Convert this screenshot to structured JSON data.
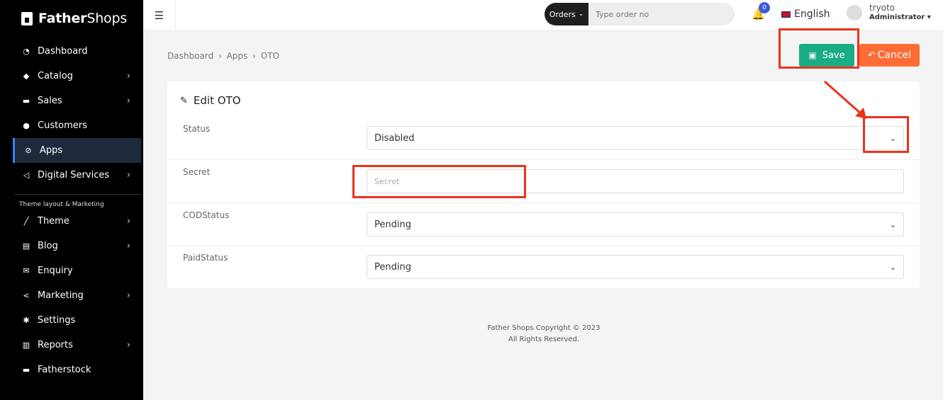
{
  "brand": {
    "name_bold": "Father",
    "name_regular": "Shops"
  },
  "sidebar": {
    "items": [
      {
        "label": "Dashboard",
        "icon": "dashboard-icon",
        "glyph": "◔",
        "has_submenu": false
      },
      {
        "label": "Catalog",
        "icon": "tag-icon",
        "glyph": "◆",
        "has_submenu": true
      },
      {
        "label": "Sales",
        "icon": "cart-icon",
        "glyph": "▬",
        "has_submenu": true
      },
      {
        "label": "Customers",
        "icon": "user-icon",
        "glyph": "●",
        "has_submenu": false
      },
      {
        "label": "Apps",
        "icon": "apps-icon",
        "glyph": "⊘",
        "has_submenu": false,
        "active": true
      },
      {
        "label": "Digital Services",
        "icon": "bullhorn-icon",
        "glyph": "◁",
        "has_submenu": true
      }
    ],
    "section_title": "Theme layout & Marketing",
    "items2": [
      {
        "label": "Theme",
        "icon": "brush-icon",
        "glyph": "╱",
        "has_submenu": true
      },
      {
        "label": "Blog",
        "icon": "newspaper-icon",
        "glyph": "▤",
        "has_submenu": true
      },
      {
        "label": "Enquiry",
        "icon": "envelope-icon",
        "glyph": "✉",
        "has_submenu": false
      },
      {
        "label": "Marketing",
        "icon": "share-icon",
        "glyph": "<",
        "has_submenu": true
      },
      {
        "label": "Settings",
        "icon": "gear-icon",
        "glyph": "✱",
        "has_submenu": false
      },
      {
        "label": "Reports",
        "icon": "chart-icon",
        "glyph": "▥",
        "has_submenu": true
      },
      {
        "label": "Fatherstock",
        "icon": "cart-icon",
        "glyph": "▬",
        "has_submenu": false
      }
    ],
    "chevron": "›"
  },
  "topbar": {
    "search_select": "Orders",
    "search_placeholder": "Type order no",
    "notification_count": "0",
    "language": "English",
    "user_name": "tryoto",
    "user_role": "Administrator"
  },
  "breadcrumb": [
    "Dashboard",
    "›",
    "Apps",
    "›",
    "OTO"
  ],
  "actions": {
    "save_label": "Save",
    "cancel_label": "Cancel"
  },
  "card": {
    "title": "Edit OTO",
    "fields": [
      {
        "label": "Status",
        "type": "select",
        "value": "Disabled"
      },
      {
        "label": "Secret",
        "type": "input",
        "value": "",
        "placeholder": "Secret"
      },
      {
        "label": "CODStatus",
        "type": "select",
        "value": "Pending"
      },
      {
        "label": "PaidStatus",
        "type": "select",
        "value": "Pending"
      }
    ]
  },
  "footer": {
    "line1": "Father Shops Copyright © 2023",
    "line2": "All Rights Reserved."
  },
  "colors": {
    "sidebar_bg": "#000000",
    "save": "#1aac83",
    "cancel": "#ff6b35",
    "annotation": "#e8341c",
    "badge": "#3b5bdb"
  }
}
